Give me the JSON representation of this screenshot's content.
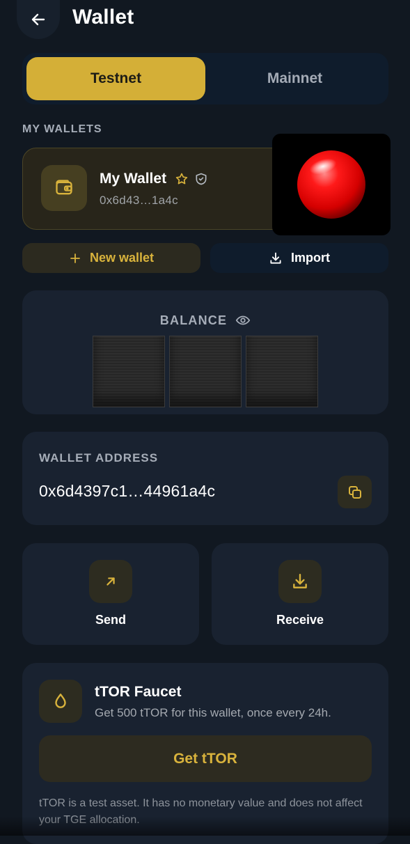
{
  "header": {
    "title": "Wallet",
    "back_icon": "arrow-left-icon"
  },
  "network": {
    "options": [
      "Testnet",
      "Mainnet"
    ],
    "selected": "Testnet"
  },
  "my_wallets": {
    "label": "MY WALLETS",
    "wallet": {
      "name": "My Wallet",
      "address_short": "0x6d43…1a4c"
    }
  },
  "actions": {
    "new_wallet": "New wallet",
    "import": "Import"
  },
  "balance": {
    "label": "BALANCE"
  },
  "address": {
    "label": "WALLET ADDRESS",
    "value": "0x6d4397c1…44961a4c"
  },
  "quick_actions": {
    "send": "Send",
    "receive": "Receive"
  },
  "faucet": {
    "title": "tTOR Faucet",
    "subtitle": "Get 500 tTOR for this wallet, once every 24h.",
    "button": "Get tTOR",
    "disclaimer": "tTOR is a test asset. It has no monetary value and does not affect your TGE allocation."
  },
  "colors": {
    "accent": "#d4af37",
    "background": "#111821",
    "card": "#192230",
    "overlay_ball": "#e60000"
  }
}
